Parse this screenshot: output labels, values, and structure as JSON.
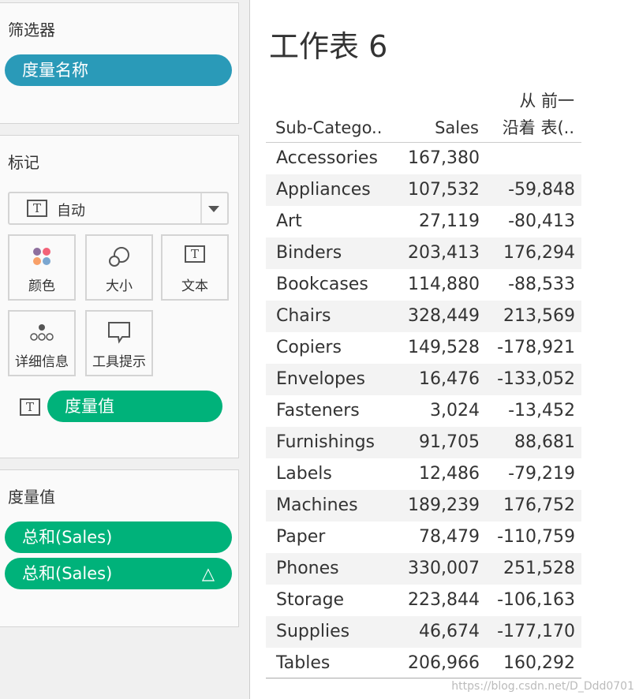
{
  "filters": {
    "title": "筛选器",
    "pill": "度量名称"
  },
  "marks": {
    "title": "标记",
    "dropdown": "自动",
    "buttons": [
      "颜色",
      "大小",
      "文本",
      "详细信息",
      "工具提示"
    ],
    "text_pill": "度量值"
  },
  "measure_values": {
    "title": "度量值",
    "pills": [
      "总和(Sales)",
      "总和(Sales)"
    ],
    "delta_icon": "△"
  },
  "sheet": {
    "title": "工作表 6",
    "headers": {
      "sub_category": "Sub-Catego..",
      "sales": "Sales",
      "diff_line1": "从 前一",
      "diff_line2": "沿着 表(.."
    },
    "rows": [
      [
        "Accessories",
        "167,380",
        ""
      ],
      [
        "Appliances",
        "107,532",
        "-59,848"
      ],
      [
        "Art",
        "27,119",
        "-80,413"
      ],
      [
        "Binders",
        "203,413",
        "176,294"
      ],
      [
        "Bookcases",
        "114,880",
        "-88,533"
      ],
      [
        "Chairs",
        "328,449",
        "213,569"
      ],
      [
        "Copiers",
        "149,528",
        "-178,921"
      ],
      [
        "Envelopes",
        "16,476",
        "-133,052"
      ],
      [
        "Fasteners",
        "3,024",
        "-13,452"
      ],
      [
        "Furnishings",
        "91,705",
        "88,681"
      ],
      [
        "Labels",
        "12,486",
        "-79,219"
      ],
      [
        "Machines",
        "189,239",
        "176,752"
      ],
      [
        "Paper",
        "78,479",
        "-110,759"
      ],
      [
        "Phones",
        "330,007",
        "251,528"
      ],
      [
        "Storage",
        "223,844",
        "-106,163"
      ],
      [
        "Supplies",
        "46,674",
        "-177,170"
      ],
      [
        "Tables",
        "206,966",
        "160,292"
      ]
    ]
  },
  "watermark": "https://blog.csdn.net/D_Ddd0701"
}
